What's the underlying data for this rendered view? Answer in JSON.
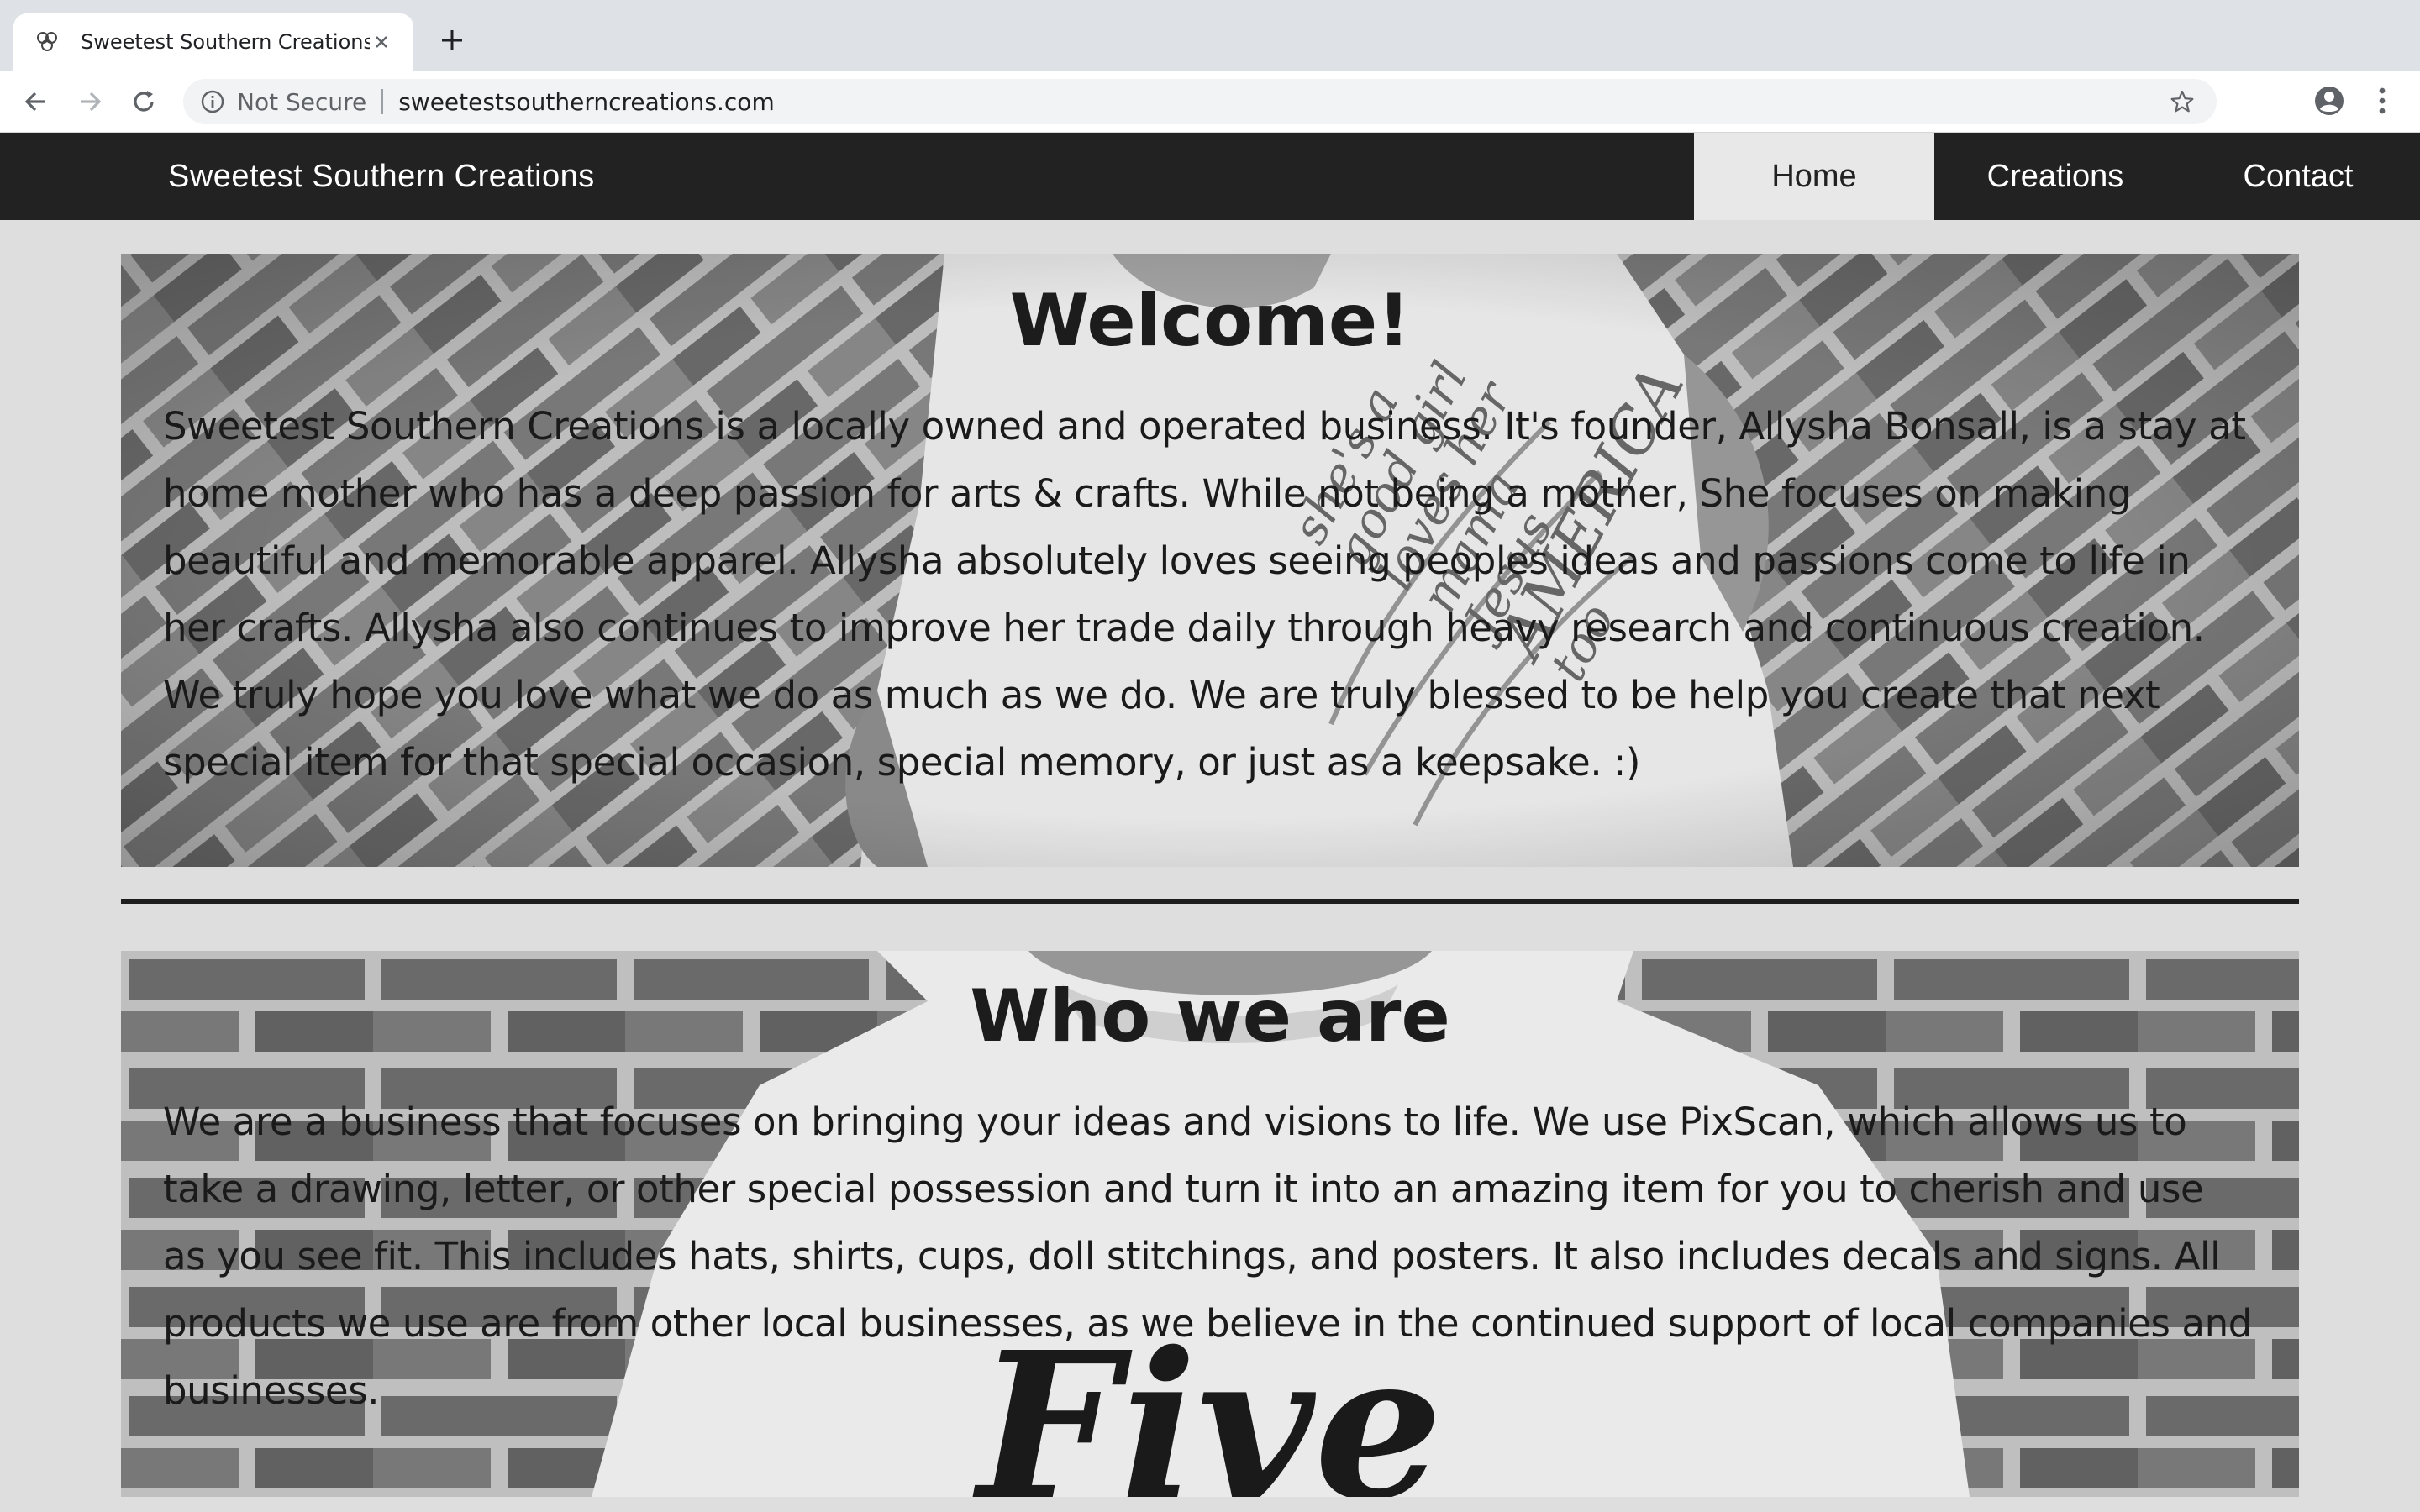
{
  "browser": {
    "tab_title": "Sweetest Southern Creations",
    "security_label": "Not Secure",
    "url": "sweetestsoutherncreations.com",
    "icons": [
      "favicon-icon",
      "close-icon",
      "plus-icon",
      "back-icon",
      "forward-icon",
      "reload-icon",
      "info-icon",
      "star-icon",
      "profile-icon",
      "menu-icon"
    ]
  },
  "site": {
    "brand": "Sweetest Southern Creations",
    "nav": [
      {
        "label": "Home",
        "active": true
      },
      {
        "label": "Creations",
        "active": false
      },
      {
        "label": "Contact",
        "active": false
      }
    ]
  },
  "sections": [
    {
      "title": "Welcome!",
      "body": "Sweetest Southern Creations is a locally owned and operated business. It's founder, Allysha Bonsall, is a stay at home mother who has a deep passion for arts & crafts. While not being a mother, She focuses on making beautiful and memorable apparel. Allysha absolutely loves seeing peoples ideas and passions come to life in her crafts. Allysha also continues to improve her trade daily through heavy research and continuous creation. We truly hope you love what we do as much as we do. We are truly blessed to be help you create that next special item for that special occasion, special memory, or just as a keepsake. :)",
      "image_text": [
        "she's a",
        "good girl",
        "loves her",
        "mama",
        "Jesus",
        "AMERICA",
        "too"
      ]
    },
    {
      "title": "Who we are",
      "body": "We are a business that focuses on bringing your ideas and visions to life. We use PixScan, which allows us to take a drawing, letter, or other special possession and turn it into an amazing item for you to cherish and use as you see fit. This includes hats, shirts, cups, doll stitchings, and posters. It also includes decals and signs. All products we use are from other local businesses, as we believe in the continued support of local companies and businesses.",
      "image_text": "Five"
    }
  ],
  "colors": {
    "nav_bg": "#222222",
    "nav_active_bg": "#e8e8e8",
    "page_bg": "#dedede",
    "divider": "#1e1e1e"
  }
}
